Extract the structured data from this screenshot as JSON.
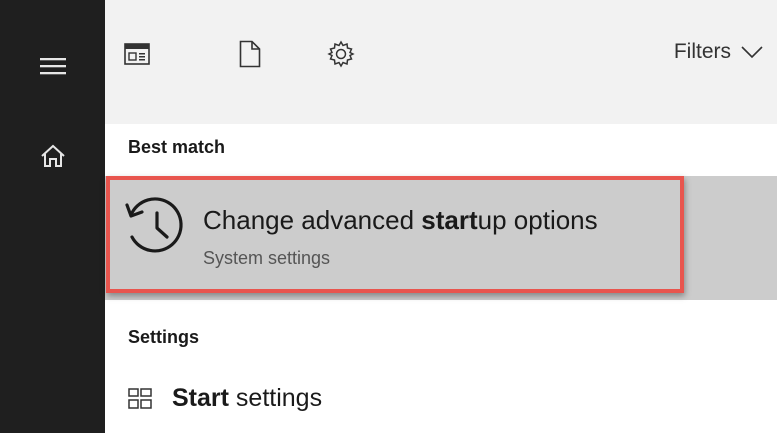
{
  "rail": {
    "items": [
      {
        "icon": "hamburger-menu-icon"
      },
      {
        "icon": "home-icon"
      }
    ]
  },
  "toolbar": {
    "icons": [
      "apps-icon",
      "documents-icon",
      "settings-gear-icon"
    ],
    "filters_label": "Filters"
  },
  "best_match": {
    "heading": "Best match",
    "title_before": "Change advanced ",
    "title_bold": "start",
    "title_after": "up options",
    "subtitle": "System settings",
    "icon": "history-clock-icon",
    "highlight_color": "#e8554e"
  },
  "settings": {
    "heading": "Settings",
    "item_bold": "Start",
    "item_rest": " settings",
    "item_icon": "start-layout-icon"
  },
  "colors": {
    "rail": "#1f1f1f",
    "toolbar": "#f2f2f2",
    "selected_row": "#cccccc"
  }
}
